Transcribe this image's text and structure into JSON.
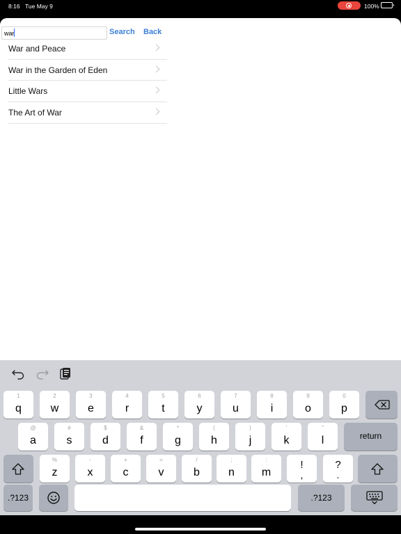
{
  "status_bar": {
    "time": "8:16",
    "date": "Tue May 9",
    "battery": "100%"
  },
  "search": {
    "value": "war",
    "search_label": "Search",
    "back_label": "Back"
  },
  "results": [
    {
      "title": "War and Peace"
    },
    {
      "title": "War in the Garden of Eden"
    },
    {
      "title": "Little Wars"
    },
    {
      "title": "The Art of War"
    }
  ],
  "keyboard": {
    "row1": [
      {
        "key": "q",
        "alt": "1"
      },
      {
        "key": "w",
        "alt": "2"
      },
      {
        "key": "e",
        "alt": "3"
      },
      {
        "key": "r",
        "alt": "4"
      },
      {
        "key": "t",
        "alt": "5"
      },
      {
        "key": "y",
        "alt": "6"
      },
      {
        "key": "u",
        "alt": "7"
      },
      {
        "key": "i",
        "alt": "8"
      },
      {
        "key": "o",
        "alt": "9"
      },
      {
        "key": "p",
        "alt": "0"
      }
    ],
    "row2": [
      {
        "key": "a",
        "alt": "@"
      },
      {
        "key": "s",
        "alt": "#"
      },
      {
        "key": "d",
        "alt": "$"
      },
      {
        "key": "f",
        "alt": "&"
      },
      {
        "key": "g",
        "alt": "*"
      },
      {
        "key": "h",
        "alt": "("
      },
      {
        "key": "j",
        "alt": ")"
      },
      {
        "key": "k",
        "alt": "'"
      },
      {
        "key": "l",
        "alt": "\""
      }
    ],
    "row3": [
      {
        "key": "z",
        "alt": "%"
      },
      {
        "key": "x",
        "alt": "-"
      },
      {
        "key": "c",
        "alt": "+"
      },
      {
        "key": "v",
        "alt": "="
      },
      {
        "key": "b",
        "alt": "/"
      },
      {
        "key": "n",
        "alt": ";"
      },
      {
        "key": "m",
        "alt": ":"
      },
      {
        "key": "!",
        "alt": ","
      },
      {
        "key": "?",
        "alt": "."
      }
    ],
    "return_label": "return",
    "numbers_label": ".?123"
  },
  "icons": {
    "undo": "undo-icon",
    "redo": "redo-icon",
    "paste": "paste-icon",
    "delete": "delete-icon",
    "shift": "shift-icon",
    "emoji": "emoji-icon",
    "dismiss": "keyboard-dismiss-icon"
  },
  "colors": {
    "accent": "#3d7fd6",
    "keyboard_bg": "#d1d3d9",
    "record": "#e8453c",
    "battery": "#4cd964"
  }
}
